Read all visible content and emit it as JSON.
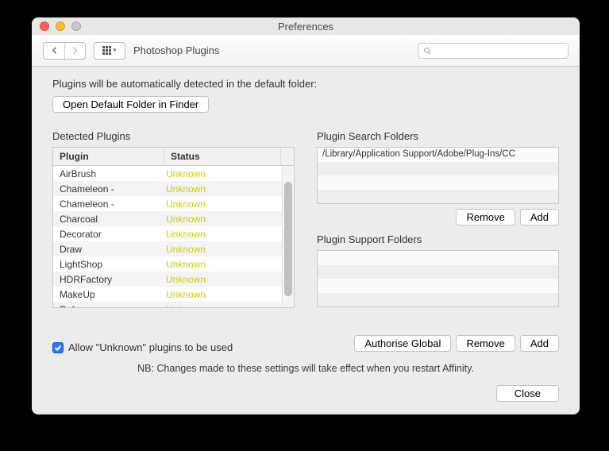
{
  "window": {
    "title": "Preferences"
  },
  "toolbar": {
    "panel_label": "Photoshop Plugins",
    "search_placeholder": ""
  },
  "intro_text": "Plugins will be automatically detected in the default folder:",
  "open_folder_label": "Open Default Folder in Finder",
  "detected": {
    "title": "Detected Plugins",
    "col_plugin": "Plugin",
    "col_status": "Status",
    "rows": [
      {
        "plugin": "AirBrush",
        "status": "Unknown"
      },
      {
        "plugin": "Chameleon -",
        "status": "Unknown"
      },
      {
        "plugin": "Chameleon -",
        "status": "Unknown"
      },
      {
        "plugin": "Charcoal",
        "status": "Unknown"
      },
      {
        "plugin": "Decorator",
        "status": "Unknown"
      },
      {
        "plugin": "Draw",
        "status": "Unknown"
      },
      {
        "plugin": "LightShop",
        "status": "Unknown"
      },
      {
        "plugin": "HDRFactory",
        "status": "Unknown"
      },
      {
        "plugin": "MakeUp",
        "status": "Unknown"
      },
      {
        "plugin": "Refocus",
        "status": "Unknown"
      }
    ]
  },
  "search_folders": {
    "title": "Plugin Search Folders",
    "rows": [
      "/Library/Application Support/Adobe/Plug-Ins/CC",
      "",
      "",
      ""
    ],
    "remove_label": "Remove",
    "add_label": "Add"
  },
  "support_folders": {
    "title": "Plugin Support Folders",
    "rows": [
      "",
      "",
      "",
      ""
    ],
    "authorise_label": "Authorise Global",
    "remove_label": "Remove",
    "add_label": "Add"
  },
  "allow_unknown": {
    "checked": true,
    "label": "Allow \"Unknown\" plugins to be used"
  },
  "note": "NB: Changes made to these settings will take effect when you restart Affinity.",
  "close_label": "Close"
}
